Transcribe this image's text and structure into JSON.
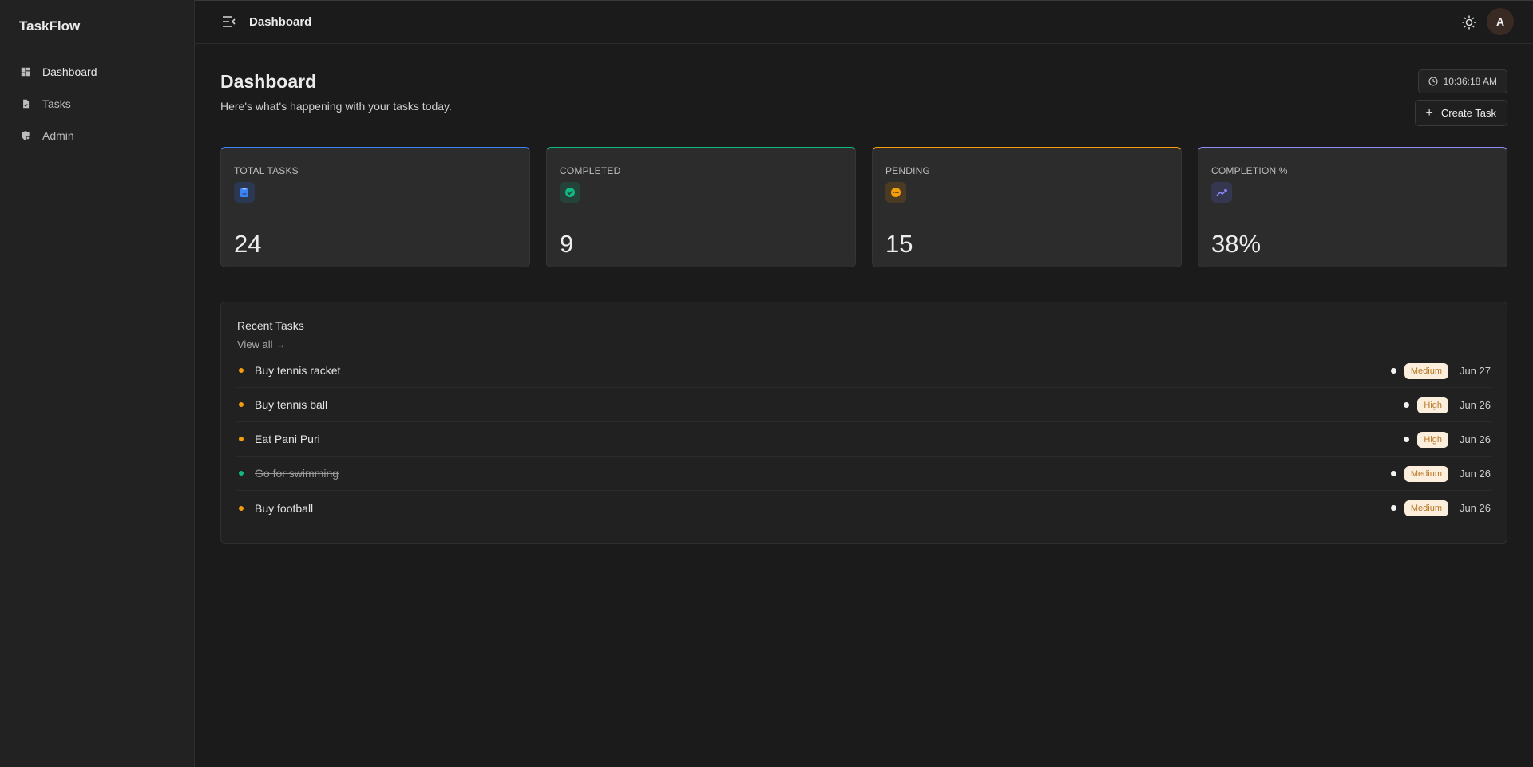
{
  "app": {
    "brand": "TaskFlow"
  },
  "sidebar": {
    "items": [
      {
        "label": "Dashboard",
        "icon": "dashboard-icon",
        "active": true
      },
      {
        "label": "Tasks",
        "icon": "file-check-icon",
        "active": false
      },
      {
        "label": "Admin",
        "icon": "shield-gear-icon",
        "active": false
      }
    ]
  },
  "topbar": {
    "title": "Dashboard",
    "avatar_letter": "A"
  },
  "header": {
    "title": "Dashboard",
    "subtitle": "Here's what's happening with your tasks today.",
    "clock": "10:36:18 AM",
    "create_label": "Create Task"
  },
  "stats": [
    {
      "label": "TOTAL TASKS",
      "value": "24",
      "accent": "#3b82f6",
      "icon": "clipboard-icon",
      "icon_bg": "#2a3852",
      "icon_color": "#3b82f6"
    },
    {
      "label": "COMPLETED",
      "value": "9",
      "accent": "#10b981",
      "icon": "check-circle-icon",
      "icon_bg": "#24423a",
      "icon_color": "#10b981"
    },
    {
      "label": "PENDING",
      "value": "15",
      "accent": "#f59e0b",
      "icon": "more-circle-icon",
      "icon_bg": "#4a3b22",
      "icon_color": "#f59e0b"
    },
    {
      "label": "COMPLETION %",
      "value": "38%",
      "accent": "#8b8cf6",
      "icon": "trending-up-icon",
      "icon_bg": "#35364f",
      "icon_color": "#8b8cf6"
    }
  ],
  "recent": {
    "title": "Recent Tasks",
    "view_all": "View all →",
    "tasks": [
      {
        "name": "Buy tennis racket",
        "status_color": "#f59e0b",
        "done": false,
        "priority": "Medium",
        "date": "Jun 27"
      },
      {
        "name": "Buy tennis ball",
        "status_color": "#f59e0b",
        "done": false,
        "priority": "High",
        "date": "Jun 26"
      },
      {
        "name": "Eat Pani Puri",
        "status_color": "#f59e0b",
        "done": false,
        "priority": "High",
        "date": "Jun 26"
      },
      {
        "name": "Go for swimming",
        "status_color": "#10b981",
        "done": true,
        "priority": "Medium",
        "date": "Jun 26"
      },
      {
        "name": "Buy football",
        "status_color": "#f59e0b",
        "done": false,
        "priority": "Medium",
        "date": "Jun 26"
      }
    ]
  }
}
